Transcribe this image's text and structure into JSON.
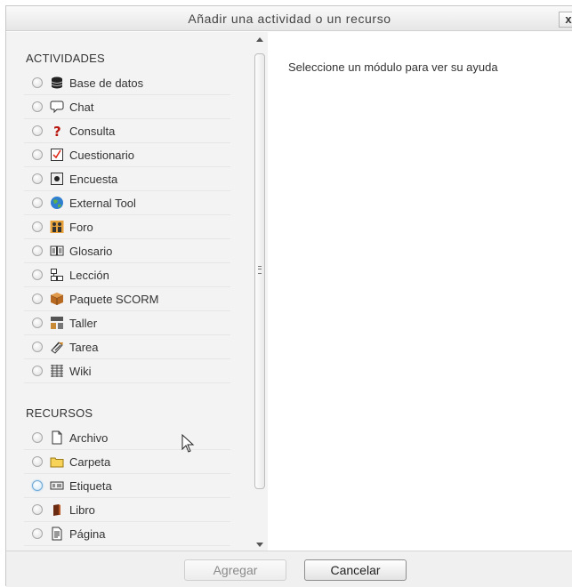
{
  "dialog": {
    "title": "Añadir una actividad o un recurso",
    "close_label": "x"
  },
  "sections": {
    "activities_title": "ACTIVIDADES",
    "resources_title": "RECURSOS"
  },
  "activities": [
    {
      "label": "Base de datos",
      "icon": "database-icon"
    },
    {
      "label": "Chat",
      "icon": "chat-icon"
    },
    {
      "label": "Consulta",
      "icon": "question-icon"
    },
    {
      "label": "Cuestionario",
      "icon": "quiz-icon"
    },
    {
      "label": "Encuesta",
      "icon": "survey-icon"
    },
    {
      "label": "External Tool",
      "icon": "globe-icon"
    },
    {
      "label": "Foro",
      "icon": "forum-icon"
    },
    {
      "label": "Glosario",
      "icon": "glossary-icon"
    },
    {
      "label": "Lección",
      "icon": "lesson-icon"
    },
    {
      "label": "Paquete SCORM",
      "icon": "package-icon"
    },
    {
      "label": "Taller",
      "icon": "workshop-icon"
    },
    {
      "label": "Tarea",
      "icon": "assignment-icon"
    },
    {
      "label": "Wiki",
      "icon": "wiki-icon"
    }
  ],
  "resources": [
    {
      "label": "Archivo",
      "icon": "file-icon"
    },
    {
      "label": "Carpeta",
      "icon": "folder-icon"
    },
    {
      "label": "Etiqueta",
      "icon": "label-icon"
    },
    {
      "label": "Libro",
      "icon": "book-icon"
    },
    {
      "label": "Página",
      "icon": "page-icon"
    }
  ],
  "help_text": "Seleccione un módulo para ver su ayuda",
  "footer": {
    "add_label": "Agregar",
    "cancel_label": "Cancelar"
  }
}
